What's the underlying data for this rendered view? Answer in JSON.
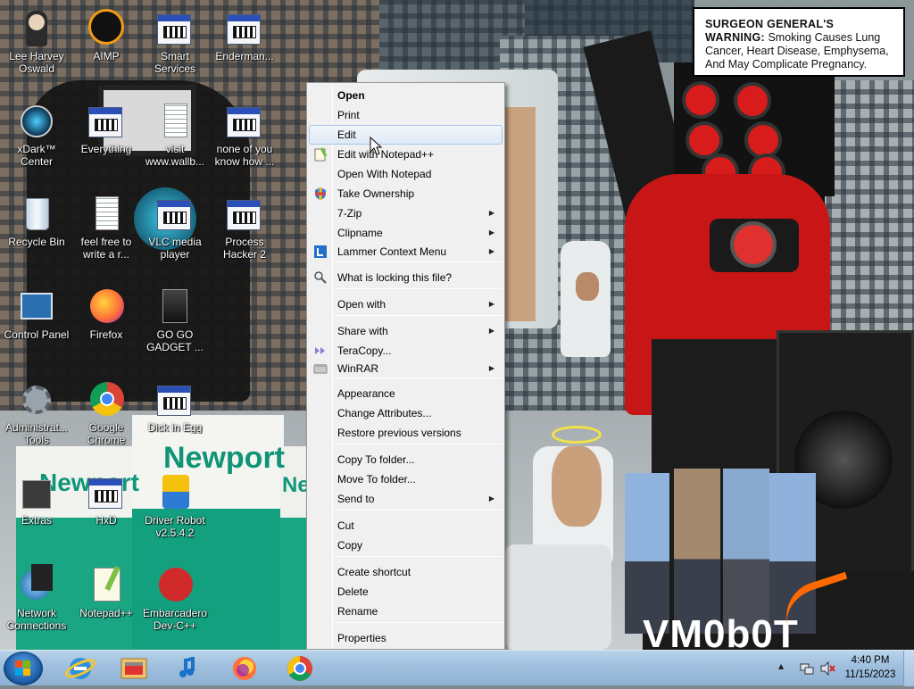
{
  "warning": {
    "heading": "SURGEON GENERAL'S WARNING:",
    "body": "Smoking Causes Lung Cancer, Heart Disease, Emphysema, And May Complicate Pregnancy."
  },
  "wallpaper": {
    "packs": [
      "Newport",
      "Newport",
      "Ne"
    ],
    "watermark": "VM0b0T"
  },
  "desktop_icons": [
    {
      "label": "Lee Harvey\nOswald",
      "icon": "person-icon"
    },
    {
      "label": "AIMP",
      "icon": "aimp-icon"
    },
    {
      "label": "Smart\nServices",
      "icon": "services-icon"
    },
    {
      "label": "Enderman...",
      "icon": "app-window-icon"
    },
    {
      "label": "xDark™\nCenter",
      "icon": "xdark-icon"
    },
    {
      "label": "Everything",
      "icon": "everything-icon"
    },
    {
      "label": "visit\nwww.wallb...",
      "icon": "document-icon"
    },
    {
      "label": "none of you\nknow how ...",
      "icon": "app-window-icon"
    },
    {
      "label": "Recycle Bin",
      "icon": "recycle-bin-icon"
    },
    {
      "label": "feel free to\nwrite a r...",
      "icon": "text-file-icon"
    },
    {
      "label": "VLC media\nplayer",
      "icon": "vlc-icon"
    },
    {
      "label": "Process\nHacker 2",
      "icon": "process-hacker-icon"
    },
    {
      "label": "Control Panel",
      "icon": "control-panel-icon"
    },
    {
      "label": "Firefox",
      "icon": "firefox-icon"
    },
    {
      "label": "GO GO\nGADGET ...",
      "icon": "gadget-icon"
    },
    {
      "label": "Administrat...\nTools",
      "icon": "admin-tools-icon"
    },
    {
      "label": "Google\nChrome",
      "icon": "chrome-icon"
    },
    {
      "label": "Dick in Egg",
      "icon": "app-window-icon"
    },
    {
      "label": "Extras",
      "icon": "extras-icon"
    },
    {
      "label": "HxD",
      "icon": "hxd-icon"
    },
    {
      "label": "Driver Robot\nv2.5.4.2",
      "icon": "driver-robot-icon"
    },
    {
      "label": "Network\nConnections",
      "icon": "network-icon"
    },
    {
      "label": "Notepad++",
      "icon": "notepadpp-icon"
    },
    {
      "label": "Embarcadero\nDev-C++",
      "icon": "devcpp-icon"
    }
  ],
  "context_menu": {
    "items": [
      {
        "label": "Open",
        "bold": true
      },
      {
        "label": "Print"
      },
      {
        "label": "Edit",
        "highlighted": true
      },
      {
        "label": "Edit with Notepad++",
        "icon": "notepadpp-icon"
      },
      {
        "label": "Open With Notepad"
      },
      {
        "label": "Take Ownership",
        "icon": "shield-icon"
      },
      {
        "label": "7-Zip",
        "submenu": true
      },
      {
        "label": "Clipname",
        "submenu": true
      },
      {
        "label": "Lammer Context Menu",
        "submenu": true,
        "icon": "lammer-icon"
      },
      {
        "label": "What is locking this file?",
        "icon": "magnifier-icon"
      },
      {
        "label": "Open with",
        "submenu": true
      },
      {
        "label": "Share with",
        "submenu": true
      },
      {
        "label": "TeraCopy...",
        "icon": "teracopy-icon"
      },
      {
        "label": "WinRAR",
        "submenu": true,
        "icon": "winrar-icon"
      },
      {
        "label": "Appearance"
      },
      {
        "label": "Change Attributes..."
      },
      {
        "label": "Restore previous versions"
      },
      {
        "label": "Copy To folder..."
      },
      {
        "label": "Move To folder..."
      },
      {
        "label": "Send to",
        "submenu": true
      },
      {
        "label": "Cut"
      },
      {
        "label": "Copy"
      },
      {
        "label": "Create shortcut"
      },
      {
        "label": "Delete"
      },
      {
        "label": "Rename"
      },
      {
        "label": "Properties"
      }
    ],
    "submenu_arrow": "▶"
  },
  "taskbar": {
    "pinned": [
      {
        "name": "Internet Explorer",
        "icon": "ie-icon"
      },
      {
        "name": "Windows Explorer",
        "icon": "explorer-icon"
      },
      {
        "name": "Music",
        "icon": "music-icon"
      },
      {
        "name": "Firefox",
        "icon": "firefox-icon"
      },
      {
        "name": "Chrome",
        "icon": "chrome-icon"
      }
    ],
    "tray": {
      "show_hidden": "▲",
      "time": "4:40 PM",
      "date": "11/15/2023"
    }
  },
  "colors": {
    "menu_bg": "#f0f0f0",
    "menu_highlight": "#dfe9f5",
    "taskbar": "#9fbfde",
    "robot_red": "#c81616"
  }
}
